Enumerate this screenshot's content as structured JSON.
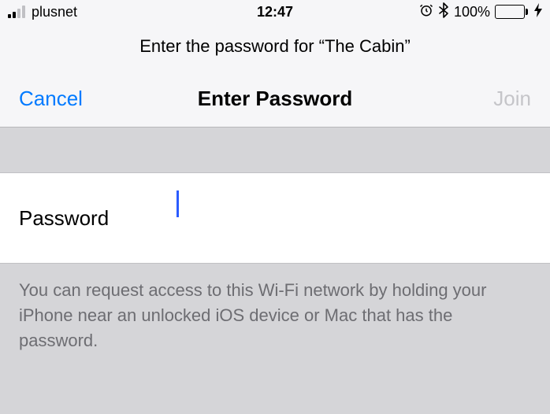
{
  "status": {
    "carrier": "plusnet",
    "time": "12:47",
    "alarm_icon": "⏰",
    "bluetooth_icon": "✱",
    "battery_percent": "100%",
    "bolt": "⚡"
  },
  "prompt": "Enter the password for “The Cabin”",
  "nav": {
    "cancel": "Cancel",
    "title": "Enter Password",
    "join": "Join"
  },
  "form": {
    "label": "Password",
    "value": ""
  },
  "hint": "You can request access to this Wi-Fi network by holding your iPhone near an unlocked iOS device or Mac that has the password."
}
